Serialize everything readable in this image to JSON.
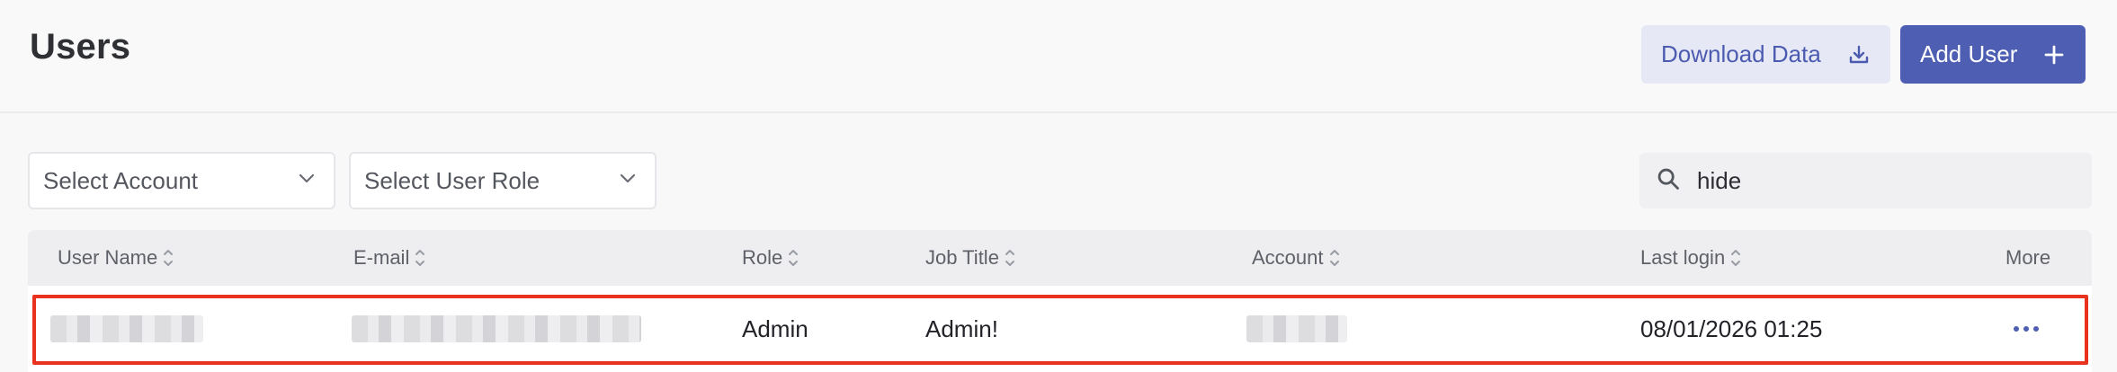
{
  "header": {
    "title": "Users",
    "download_label": "Download Data",
    "add_user_label": "Add User"
  },
  "filters": {
    "account_placeholder": "Select Account",
    "role_placeholder": "Select User Role",
    "search_value": "hide"
  },
  "table": {
    "columns": [
      "User Name",
      "E-mail",
      "Role",
      "Job Title",
      "Account",
      "Last login",
      "More"
    ],
    "rows": [
      {
        "user_name": "",
        "email": "",
        "role": "Admin",
        "job_title": "Admin!",
        "account": "",
        "last_login": "08/01/2026 01:25"
      }
    ]
  },
  "colors": {
    "accent": "#4e5fb3",
    "highlight": "#e8321e"
  }
}
